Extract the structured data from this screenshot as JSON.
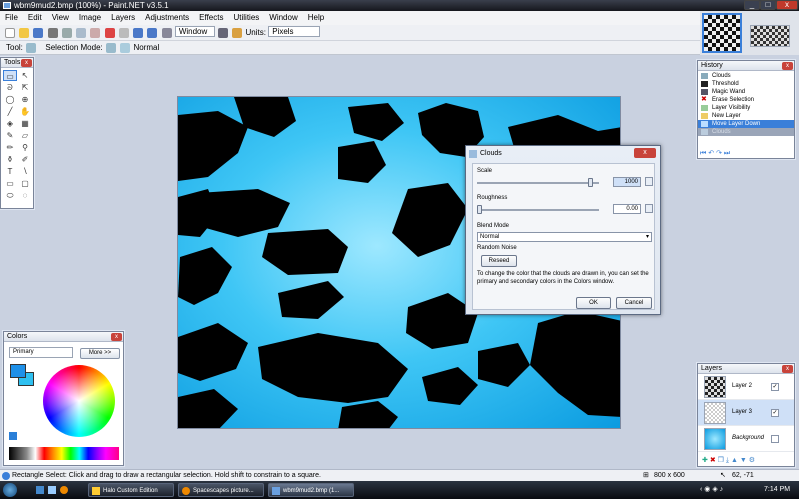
{
  "window": {
    "title": "wbm9mud2.bmp (100%) - Paint.NET v3.5.1"
  },
  "menu": [
    "File",
    "Edit",
    "View",
    "Image",
    "Layers",
    "Adjustments",
    "Effects",
    "Utilities",
    "Window",
    "Help"
  ],
  "toolbar": {
    "window_combo": "Window",
    "units_label": "Units:",
    "units_value": "Pixels"
  },
  "toolbar2": {
    "tool_label": "Tool:",
    "selection_mode_label": "Selection Mode:",
    "blend_value": "Normal"
  },
  "tools_panel": {
    "title": "Tools"
  },
  "history_panel": {
    "title": "History",
    "items": [
      {
        "label": "Clouds",
        "state": "normal"
      },
      {
        "label": "Threshold",
        "state": "normal"
      },
      {
        "label": "Magic Wand",
        "state": "normal"
      },
      {
        "label": "Erase Selection",
        "state": "normal"
      },
      {
        "label": "Layer Visibility",
        "state": "normal"
      },
      {
        "label": "New Layer",
        "state": "normal"
      },
      {
        "label": "Move Layer Down",
        "state": "selected"
      },
      {
        "label": "Clouds",
        "state": "dim"
      }
    ]
  },
  "colors_panel": {
    "title": "Colors",
    "primary_select": "Primary",
    "more_button": "More >>",
    "primary_color": "#1e90e8",
    "secondary_color": "#2ec0f0"
  },
  "layers_panel": {
    "title": "Layers",
    "layers": [
      {
        "name": "Layer 2",
        "checked": "✓"
      },
      {
        "name": "Layer 3",
        "checked": "✓"
      },
      {
        "name": "Background",
        "checked": ""
      }
    ]
  },
  "dialog": {
    "title": "Clouds",
    "scale_label": "Scale",
    "scale_value": "1000",
    "scale_level": 0.95,
    "roughness_label": "Roughness",
    "roughness_value": "0.00",
    "roughness_level": 0.0,
    "blend_mode_label": "Blend Mode",
    "blend_mode_value": "Normal",
    "random_noise_label": "Random Noise",
    "reseed_button": "Reseed",
    "hint": "To change the color that the clouds are drawn in, you can set the primary and secondary colors in the Colors window.",
    "ok_button": "OK",
    "cancel_button": "Cancel"
  },
  "status": {
    "message": "Rectangle Select: Click and drag to draw a rectangular selection. Hold shift to constrain to a square.",
    "image_size": "800 x 600",
    "cursor_pos": "62, -71"
  },
  "taskbar": {
    "buttons": [
      "Halo Custom Edition",
      "Spacescapes picture...",
      "wbm9mud2.bmp (1..."
    ],
    "clock": "7:14 PM"
  },
  "colors": {
    "accent": "#3a7fd9",
    "canvas_blue": "#0a9be0"
  }
}
